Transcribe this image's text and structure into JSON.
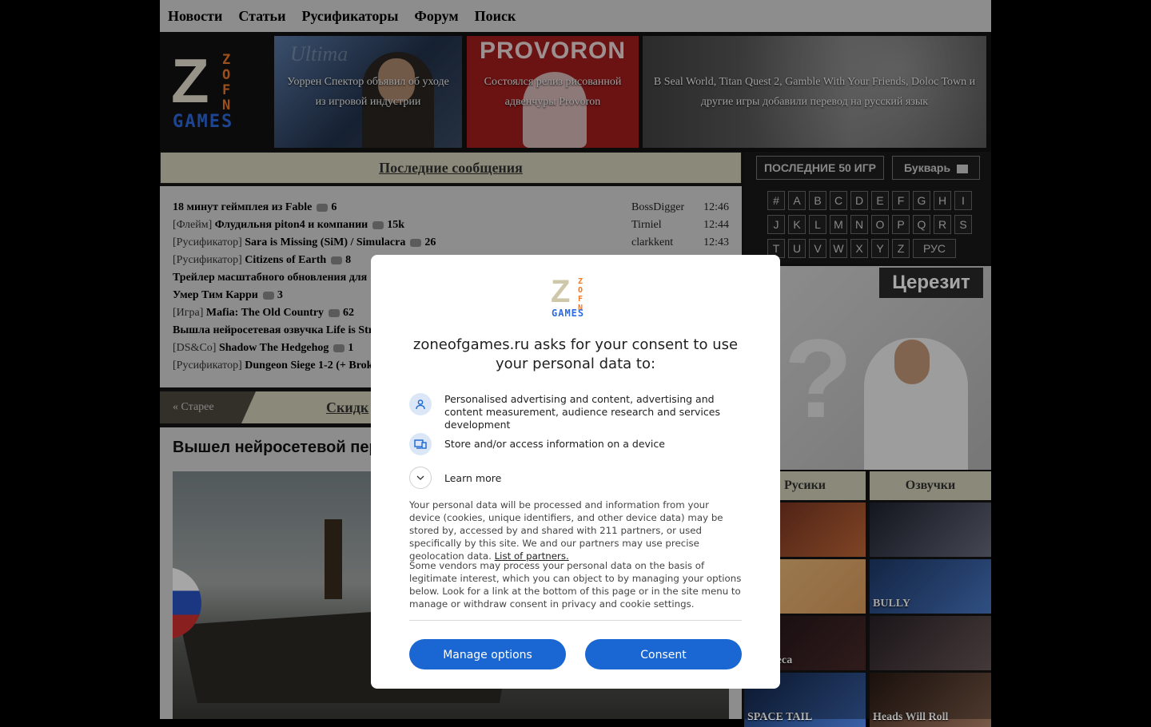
{
  "nav": [
    "Новости",
    "Статьи",
    "Русификаторы",
    "Форум",
    "Поиск"
  ],
  "logo": {
    "z": "Z",
    "zone": "Z\nO\nN\nE",
    "games": "GAMES"
  },
  "banners": [
    "Уоррен Спектор объявил об уходе из игровой индустрии",
    "Состоялся релиз рисованной адвенчуры Provoron",
    "В Seal World, Titan Quest 2, Gamble With Your Friends, Doloc Town и другие игры добавили перевод на русский язык"
  ],
  "banner_provoron_title": "PROVORON",
  "latest": {
    "title": "Последние сообщения",
    "messages": [
      {
        "cat": "",
        "title": "18 минут геймплея из Fable",
        "count": "6",
        "user": "BossDigger",
        "time": "12:46"
      },
      {
        "cat": "[Флейм]",
        "title": "Флудильня piton4 и компании",
        "count": "15k",
        "user": "Tirniel",
        "time": "12:44"
      },
      {
        "cat": "[Русификатор]",
        "title": "Sara is Missing (SiM) / Simulacra",
        "count": "26",
        "user": "clarkkent",
        "time": "12:43"
      },
      {
        "cat": "[Русификатор]",
        "title": "Citizens of Earth",
        "count": "8",
        "user": "",
        "time": ""
      },
      {
        "cat": "",
        "title": "Трейлер масштабного обновления для",
        "count": "",
        "user": "",
        "time": ""
      },
      {
        "cat": "",
        "title": "Умер Тим Карри",
        "count": "3",
        "user": "",
        "time": ""
      },
      {
        "cat": "[Игра]",
        "title": "Mafia: The Old Country",
        "count": "62",
        "user": "",
        "time": ""
      },
      {
        "cat": "",
        "title": "Вышла нейросетевая озвучка Life is Str",
        "count": "",
        "user": "",
        "time": ""
      },
      {
        "cat": "[DS&Co]",
        "title": "Shadow The Hedgehog",
        "count": "1",
        "user": "",
        "time": ""
      },
      {
        "cat": "[Русификатор]",
        "title": "Dungeon Siege 1-2 (+ Brok",
        "count": "",
        "user": "",
        "time": ""
      }
    ]
  },
  "discounts": {
    "older": "« Старее",
    "title": "Скидк"
  },
  "article": {
    "title": "Вышел нейросетевой пер"
  },
  "right": {
    "btn_last50": "ПОСЛЕДНИЕ 50 ИГР",
    "btn_bukvar": "Букварь",
    "alphabet": [
      "#",
      "A",
      "B",
      "C",
      "D",
      "E",
      "F",
      "G",
      "H",
      "I",
      "J",
      "K",
      "L",
      "M",
      "N",
      "O",
      "P",
      "Q",
      "R",
      "S",
      "T",
      "U",
      "V",
      "W",
      "X",
      "Y",
      "Z",
      "РУС"
    ],
    "ad_brand": "Церезит",
    "tab_rusiki": "Русики",
    "tab_ozvuchki": "Озвучки",
    "thumb_labels": [
      "",
      "",
      "",
      "BULLY",
      "м Велеса",
      "",
      "SPACE TAIL",
      "Heads Will Roll"
    ]
  },
  "consent": {
    "heading": "zoneofgames.ru asks for your consent to use your personal data to:",
    "purposes": [
      {
        "icon": "person-icon",
        "text": "Personalised advertising and content, advertising and content measurement, audience research and services development"
      },
      {
        "icon": "device-icon",
        "text": "Store and/or access information on a device"
      }
    ],
    "learn_more": "Learn more",
    "para1": "Your personal data will be processed and information from your device (cookies, unique identifiers, and other device data) may be stored by, accessed by and shared with 211 partners, or used specifically by this site. We and our partners may use precise geolocation data.",
    "partners_link": "List of partners.",
    "para2": "Some vendors may process your personal data on the basis of legitimate interest, which you can object to by managing your options below. Look for a link at the bottom of this page or in the site menu to manage or withdraw consent in privacy and cookie settings.",
    "manage_btn": "Manage options",
    "consent_btn": "Consent"
  },
  "colors": {
    "accent": "#1a66d2",
    "panel": "#d9d9d9",
    "header_bar": "#d6d4bc",
    "logo_orange": "#f07a28",
    "logo_blue": "#2f6be0"
  }
}
